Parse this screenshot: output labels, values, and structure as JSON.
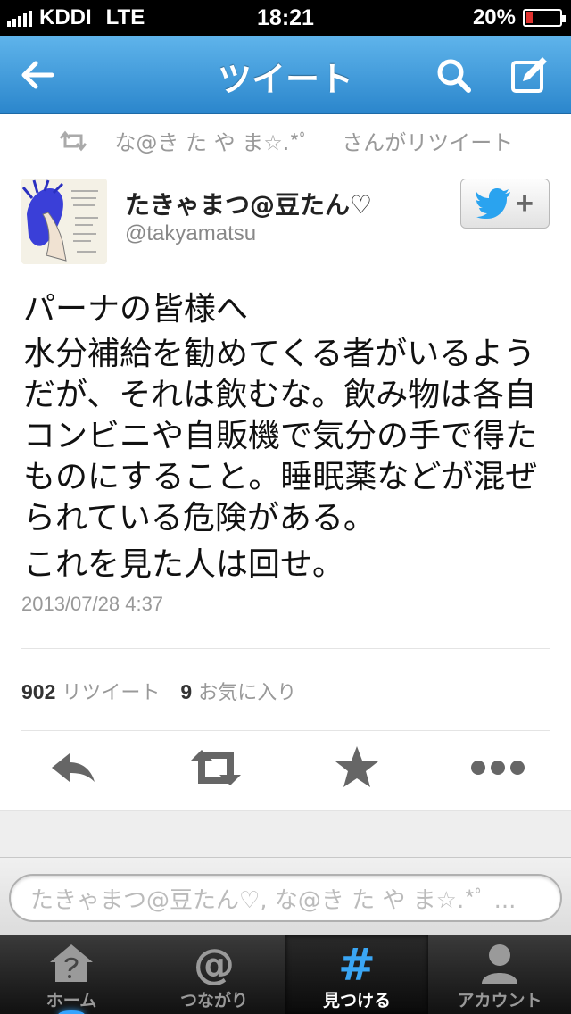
{
  "status_bar": {
    "carrier": "KDDI",
    "network": "LTE",
    "time": "18:21",
    "battery": "20%",
    "battery_level": 0.2
  },
  "nav": {
    "title": "ツイート",
    "accent_color": "#2b86cc"
  },
  "retweet_context": {
    "user": "な@き た や ま☆.*ﾟ",
    "suffix": "さんがリツイート"
  },
  "tweet": {
    "author_name": "たきゃまつ@豆たん♡",
    "author_handle": "@takyamatsu",
    "lines": [
      "パーナの皆様へ",
      "水分補給を勧めてくる者がいるよう",
      "だが、それは飲むな。飲み物は各自",
      "コンビニや自販機で気分の手で得た",
      "ものにすること。睡眠薬などが混ぜ",
      "られている危険がある。",
      "これを見た人は回せ。"
    ],
    "timestamp": "2013/07/28 4:37",
    "retweet_count": "902",
    "retweet_label": "リツイート",
    "favorite_count": "9",
    "favorite_label": "お気に入り"
  },
  "reply": {
    "placeholder": "たきゃまつ@豆たん♡, な@き た や ま☆.*ﾟ ..."
  },
  "tabs": [
    {
      "label": "ホーム",
      "icon": "home-icon"
    },
    {
      "label": "つながり",
      "icon": "at-icon"
    },
    {
      "label": "見つける",
      "icon": "hash-icon",
      "active": true
    },
    {
      "label": "アカウント",
      "icon": "person-icon"
    }
  ]
}
